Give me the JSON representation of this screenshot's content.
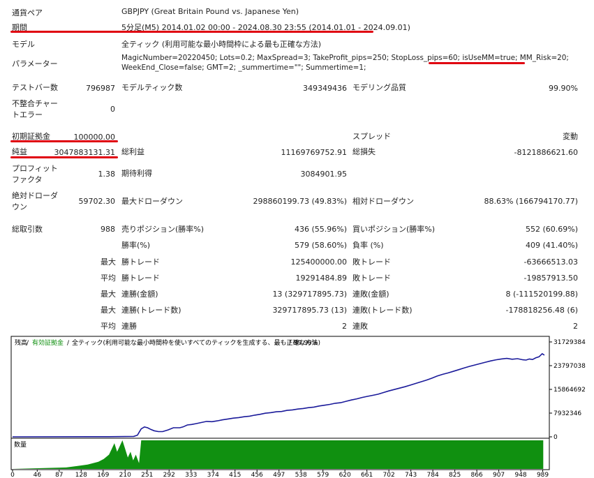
{
  "header": {
    "symbol_label": "通貨ペア",
    "symbol_value": "GBPJPY (Great Britain Pound vs. Japanese Yen)",
    "period_label": "期間",
    "period_value": "5分足(M5) 2014.01.02 00:00 - 2024.08.30 23:55 (2014.01.01 - 2024.09.01)",
    "model_label": "モデル",
    "model_value": "全ティック (利用可能な最小時間枠による最も正確な方法)",
    "params_label": "パラメーター",
    "params_line1": "MagicNumber=20220450; Lots=0.2; MaxSpread=3; TakeProfit_pips=250; StopLoss_pips=60; isUseMM=true; MM_Risk=20;",
    "params_line2": "WeekEnd_Close=false; GMT=2; _summertime=\"\"; Summertime=1;"
  },
  "stats": {
    "bars_label": "テストバー数",
    "bars_value": "796987",
    "ticks_label": "モデルティック数",
    "ticks_value": "349349436",
    "quality_label": "モデリング品質",
    "quality_value": "99.90%",
    "mismatch_label_1": "不整合チャー",
    "mismatch_label_2": "トエラー",
    "mismatch_value": "0",
    "deposit_label": "初期証拠金",
    "deposit_value": "100000.00",
    "spread_label": "スプレッド",
    "spread_value": "変動",
    "netprofit_label": "純益",
    "netprofit_value": "3047883131.31",
    "grossprofit_label": "総利益",
    "grossprofit_value": "11169769752.91",
    "grossloss_label": "総損失",
    "grossloss_value": "-8121886621.60",
    "pf_label_1": "プロフィット",
    "pf_label_2": "ファクタ",
    "pf_value": "1.38",
    "expected_label": "期待利得",
    "expected_value": "3084901.95",
    "absdd_label_1": "絶対ドローダ",
    "absdd_label_2": "ウン",
    "absdd_value": "59702.30",
    "maxdd_label": "最大ドローダウン",
    "maxdd_value": "298860199.73 (49.83%)",
    "reldd_label": "相対ドローダウン",
    "reldd_value": "88.63% (166794170.77)",
    "trades_label": "総取引数",
    "trades_value": "988",
    "short_label": "売りポジション(勝率%)",
    "short_value": "436 (55.96%)",
    "long_label": "買いポジション(勝率%)",
    "long_value": "552 (60.69%)",
    "win_label": "勝率(%)",
    "win_value": "579 (58.60%)",
    "loss_label": "負率 (%)",
    "loss_value": "409 (41.40%)",
    "max_word": "最大",
    "avg_word": "平均",
    "largest_profit_label": "勝トレード",
    "largest_profit_value": "125400000.00",
    "largest_loss_label": "敗トレード",
    "largest_loss_value": "-63666513.03",
    "avg_profit_label": "勝トレード",
    "avg_profit_value": "19291484.89",
    "avg_loss_label": "敗トレード",
    "avg_loss_value": "-19857913.50",
    "max_consec_wins_money_label": "連勝(金額)",
    "max_consec_wins_money_value": "13 (329717895.73)",
    "max_consec_losses_money_label": "連敗(金額)",
    "max_consec_losses_money_value": "8 (-111520199.88)",
    "max_consec_wins_trades_label": "連勝(トレード数)",
    "max_consec_wins_trades_value": "329717895.73 (13)",
    "max_consec_losses_trades_label": "連敗(トレード数)",
    "max_consec_losses_trades_value": "-178818256.48 (6)",
    "avg_consec_wins_label": "連勝",
    "avg_consec_wins_value": "2",
    "avg_consec_losses_label": "連敗",
    "avg_consec_losses_value": "2"
  },
  "chart_legend": {
    "balance": "残高",
    "equity": "有効証拠金",
    "model": "全ティック(利用可能な最小時間枠を使いすべてのティックを生成する、最も正確な方法)",
    "quality": "99.90%",
    "volume_label": "数量"
  },
  "colors": {
    "balance_line": "#1a1a9a",
    "volume_fill": "#109010",
    "highlight": "#e00010",
    "equity_legend": "#109010"
  },
  "chart_data": {
    "type": "line",
    "x_ticks": [
      0,
      46,
      87,
      128,
      169,
      210,
      251,
      292,
      333,
      374,
      415,
      456,
      497,
      538,
      579,
      620,
      661,
      702,
      743,
      784,
      825,
      866,
      907,
      948,
      989
    ],
    "y_ticks": [
      "31729384",
      "23797038",
      "15864692",
      "7932346",
      "0"
    ],
    "ylim": [
      0,
      35000000
    ],
    "xlim": [
      0,
      1000
    ],
    "series": [
      {
        "x": [
          0,
          180,
          226,
          233,
          236,
          240,
          246,
          252,
          258,
          264,
          272,
          280,
          290,
          300,
          306,
          312,
          318,
          326,
          334,
          342,
          352,
          362,
          372,
          382,
          392,
          402,
          412,
          422,
          432,
          442,
          452,
          462,
          472,
          482,
          492,
          502,
          512,
          522,
          532,
          542,
          552,
          562,
          572,
          582,
          592,
          602,
          612,
          622,
          632,
          642,
          652,
          662,
          672,
          682,
          692,
          702,
          712,
          722,
          732,
          742,
          752,
          762,
          772,
          782,
          792,
          802,
          812,
          822,
          832,
          842,
          852,
          862,
          872,
          882,
          892,
          902,
          912,
          922,
          932,
          942,
          952,
          958,
          964,
          970,
          976,
          982,
          988,
          992
        ],
        "y": [
          0,
          50000,
          150000,
          600000,
          1600000,
          2900000,
          3600000,
          3300000,
          2700000,
          2200000,
          1900000,
          1900000,
          2500000,
          3300000,
          3300000,
          3300000,
          3600000,
          4300000,
          4500000,
          4800000,
          5200000,
          5600000,
          5500000,
          5800000,
          6200000,
          6500000,
          6800000,
          7000000,
          7300000,
          7500000,
          7900000,
          8200000,
          8600000,
          8800000,
          9100000,
          9200000,
          9600000,
          9800000,
          10100000,
          10300000,
          10600000,
          10800000,
          11200000,
          11500000,
          11800000,
          12200000,
          12400000,
          12900000,
          13400000,
          13800000,
          14300000,
          14700000,
          15100000,
          15500000,
          16100000,
          16700000,
          17200000,
          17700000,
          18200000,
          18800000,
          19400000,
          20000000,
          20600000,
          21300000,
          22100000,
          22700000,
          23200000,
          23800000,
          24400000,
          25000000,
          25600000,
          26100000,
          26600000,
          27100000,
          27600000,
          28000000,
          28300000,
          28500000,
          28200000,
          28400000,
          28000000,
          27900000,
          28300000,
          28100000,
          28700000,
          29100000,
          30200000,
          29700000
        ]
      }
    ],
    "volume": {
      "x": [
        0,
        100,
        120,
        140,
        160,
        170,
        180,
        185,
        190,
        195,
        200,
        205,
        210,
        215,
        220,
        225,
        230,
        236,
        240,
        990
      ],
      "v": [
        0,
        0.05,
        0.1,
        0.15,
        0.25,
        0.35,
        0.5,
        0.7,
        0.9,
        0.6,
        0.8,
        1.0,
        0.7,
        0.4,
        0.6,
        0.3,
        0.5,
        0.2,
        1.0,
        1.0
      ]
    }
  }
}
